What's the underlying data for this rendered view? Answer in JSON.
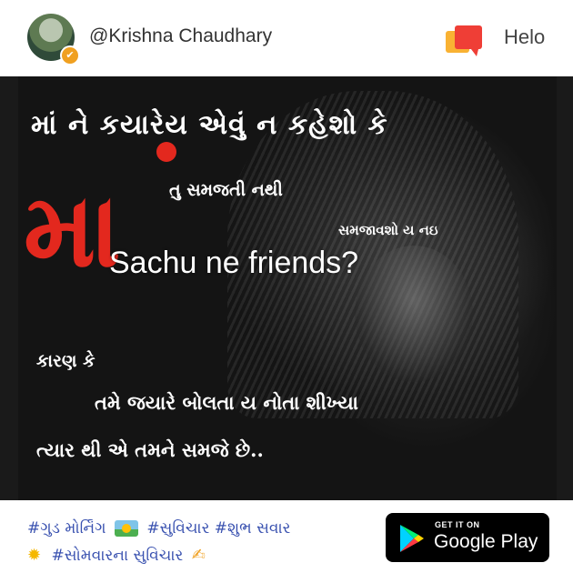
{
  "header": {
    "username": "@Krishna Chaudhary",
    "app_name": "Helo"
  },
  "post_image": {
    "line1": "માં ને કયારેય એવું ન કહેશો કે",
    "big_letter": "મા",
    "line2": "તુ સમજતી નથી",
    "line3": "સમજાવશો ય નઇ",
    "overlay_caption": "Sachu ne friends?",
    "line4": "કારણ કે",
    "line5": "તમે જયારે બોલતા ય નોતા શીખ્યા",
    "line6": "ત્યાર થી એ તમને સમજે છે.."
  },
  "footer": {
    "tag1": "#ગુડ મોર્નિંગ",
    "tag2": "#સુવિચાર #શુભ સવાર",
    "tag3": "#સોમવારના સુવિચાર",
    "store_small": "GET IT ON",
    "store_big": "Google Play"
  },
  "colors": {
    "accent_red": "#e3281e",
    "tag_blue": "#3a52b0",
    "helo_orange": "#f7931e"
  }
}
